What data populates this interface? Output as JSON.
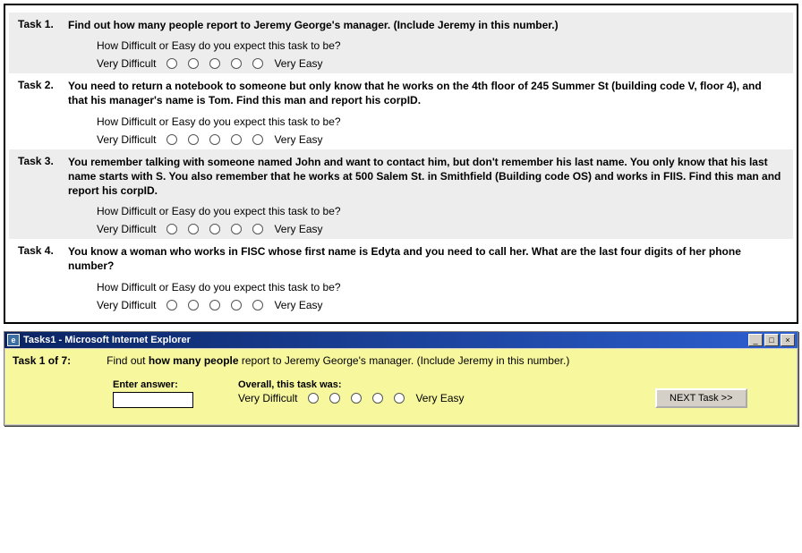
{
  "top": {
    "prompt": "How Difficult or Easy do you expect this task to be?",
    "scale_left": "Very Difficult",
    "scale_right": "Very Easy",
    "tasks": [
      {
        "num": "Task 1.",
        "desc": "Find out how many people report to Jeremy George's manager. (Include Jeremy in this number.)",
        "bg": "gray"
      },
      {
        "num": "Task 2.",
        "desc": "You need to return a notebook to someone but only know that he works on the 4th floor of 245 Summer St (building code V, floor 4), and that his manager's name is Tom. Find this man and report his corpID.",
        "bg": "white"
      },
      {
        "num": "Task 3.",
        "desc": "You remember talking with someone named John and want to contact him, but don't remember his last name. You only know that his last name starts with S. You also remember that he works at 500 Salem St. in Smithfield (Building code OS) and works in FIIS. Find this man and report his corpID.",
        "bg": "gray"
      },
      {
        "num": "Task 4.",
        "desc": "You know a woman who works in FISC whose first name is Edyta and you need to call her. What are the last four digits of her phone number?",
        "bg": "white"
      }
    ]
  },
  "bottom": {
    "window_title": "Tasks1 - Microsoft Internet Explorer",
    "task_of": "Task 1 of 7:",
    "instruction_prefix": "Find out ",
    "instruction_bold": "how many people",
    "instruction_suffix": " report to Jeremy George's manager. (Include Jeremy in this number.)",
    "enter_label": "Enter answer:",
    "overall_label": "Overall, this task was:",
    "scale_left": "Very Difficult",
    "scale_right": "Very Easy",
    "next_label": "NEXT Task >>",
    "answer_value": ""
  }
}
